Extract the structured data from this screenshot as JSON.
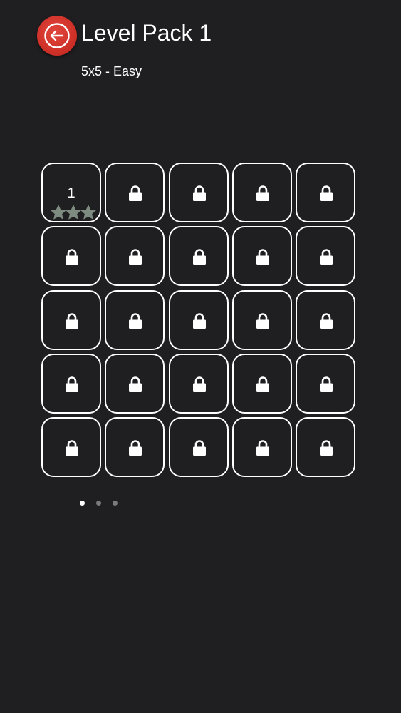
{
  "header": {
    "back_icon": "arrow-left-circle-icon",
    "title": "Level Pack 1",
    "subtitle": "5x5 - Easy"
  },
  "colors": {
    "background": "#1f1e21",
    "back_button": "#d4352c",
    "tile_border": "#ffffff",
    "star_filled": "#7e8b80",
    "dot_inactive": "#7a797d",
    "dot_active": "#ffffff"
  },
  "levels": [
    {
      "label": "1",
      "locked": false,
      "stars": 3
    },
    {
      "label": "",
      "locked": true,
      "stars": 0
    },
    {
      "label": "",
      "locked": true,
      "stars": 0
    },
    {
      "label": "",
      "locked": true,
      "stars": 0
    },
    {
      "label": "",
      "locked": true,
      "stars": 0
    },
    {
      "label": "",
      "locked": true,
      "stars": 0
    },
    {
      "label": "",
      "locked": true,
      "stars": 0
    },
    {
      "label": "",
      "locked": true,
      "stars": 0
    },
    {
      "label": "",
      "locked": true,
      "stars": 0
    },
    {
      "label": "",
      "locked": true,
      "stars": 0
    },
    {
      "label": "",
      "locked": true,
      "stars": 0
    },
    {
      "label": "",
      "locked": true,
      "stars": 0
    },
    {
      "label": "",
      "locked": true,
      "stars": 0
    },
    {
      "label": "",
      "locked": true,
      "stars": 0
    },
    {
      "label": "",
      "locked": true,
      "stars": 0
    },
    {
      "label": "",
      "locked": true,
      "stars": 0
    },
    {
      "label": "",
      "locked": true,
      "stars": 0
    },
    {
      "label": "",
      "locked": true,
      "stars": 0
    },
    {
      "label": "",
      "locked": true,
      "stars": 0
    },
    {
      "label": "",
      "locked": true,
      "stars": 0
    },
    {
      "label": "",
      "locked": true,
      "stars": 0
    },
    {
      "label": "",
      "locked": true,
      "stars": 0
    },
    {
      "label": "",
      "locked": true,
      "stars": 0
    },
    {
      "label": "",
      "locked": true,
      "stars": 0
    },
    {
      "label": "",
      "locked": true,
      "stars": 0
    }
  ],
  "lock_icon": "lock-icon",
  "star_icon": "star-icon",
  "pager": {
    "total_pages": 3,
    "current_page": 1
  }
}
